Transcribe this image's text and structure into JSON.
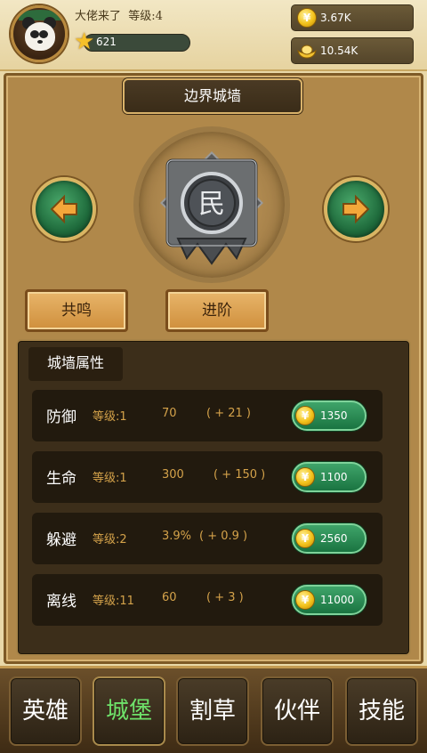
{
  "player": {
    "name": "大佬来了",
    "level_label": "等级:4",
    "xp": "621"
  },
  "resources": {
    "gold": "3.67K",
    "ingot": "10.54K",
    "coin_symbol": "¥"
  },
  "wall": {
    "title": "边界城墙",
    "emblem_char": "民"
  },
  "actions": {
    "resonate": "共鸣",
    "advance": "进阶"
  },
  "attributes": {
    "title": "城墙属性",
    "rows": [
      {
        "name": "防御",
        "level": "等级:1",
        "value": "70",
        "bonus": "( + 21 )",
        "cost": "1350"
      },
      {
        "name": "生命",
        "level": "等级:1",
        "value": "300",
        "bonus": "( + 150 )",
        "cost": "1100"
      },
      {
        "name": "躲避",
        "level": "等级:2",
        "value": "3.9%",
        "bonus": "( + 0.9 )",
        "cost": "2560"
      },
      {
        "name": "离线",
        "level": "等级:11",
        "value": "60",
        "bonus": "( + 3 )",
        "cost": "11000"
      }
    ]
  },
  "nav": {
    "items": [
      "英雄",
      "城堡",
      "割草",
      "伙伴",
      "技能"
    ],
    "active": "城堡"
  },
  "colors": {
    "accent_green": "#6ee26a",
    "value_orange": "#d4a24a"
  }
}
